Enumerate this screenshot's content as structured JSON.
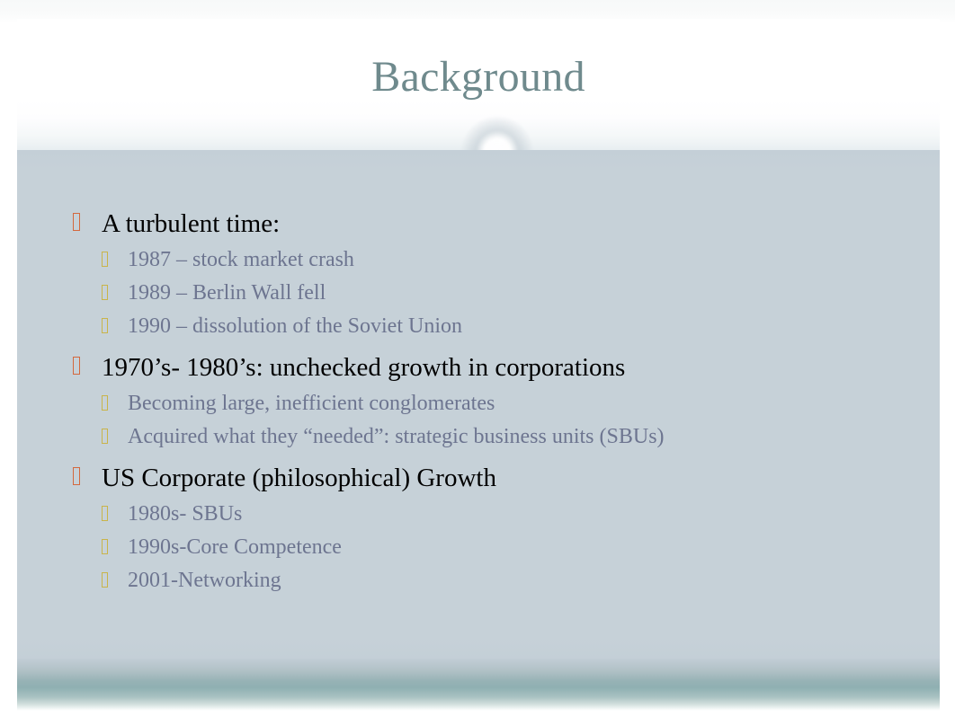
{
  "slide": {
    "title": "Background",
    "colors": {
      "title": "#6f8a8d",
      "body_background": "#c6d1d8",
      "footer_band": "#8fb0b2",
      "level1_text": "#000000",
      "level2_text": "#6d7590",
      "level1_marker": "#d4683d",
      "level2_marker": "#c9b44a"
    },
    "bullets": [
      {
        "text": "A turbulent time:",
        "children": [
          {
            "text": "1987 – stock market crash"
          },
          {
            "text": "1989 – Berlin Wall fell"
          },
          {
            "text": "1990 – dissolution of the Soviet Union"
          }
        ]
      },
      {
        "text": "1970’s- 1980’s: unchecked growth in corporations",
        "children": [
          {
            "text": "Becoming large, inefficient conglomerates"
          },
          {
            "text": "Acquired what they “needed”: strategic business units (SBUs)"
          }
        ]
      },
      {
        "text": "US Corporate (philosophical) Growth",
        "children": [
          {
            "text": "1980s- SBUs"
          },
          {
            "text": "1990s-Core Competence"
          },
          {
            "text": "2001-Networking"
          }
        ]
      }
    ]
  }
}
